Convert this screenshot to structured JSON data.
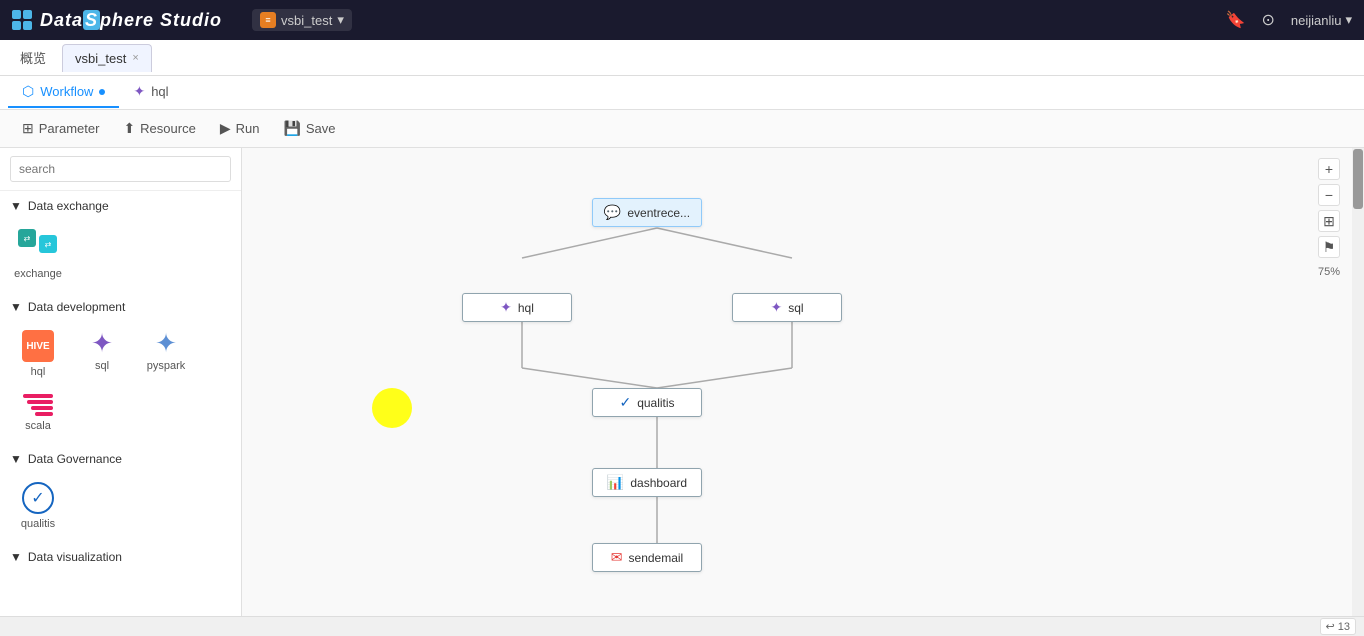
{
  "app": {
    "title": "DataSphere Studio"
  },
  "topbar": {
    "logo_text": "Data Sphere Studio",
    "project_name": "vsbi_test",
    "dropdown_arrow": "▾",
    "bookmark_icon": "🔖",
    "github_icon": "⊙",
    "user_name": "neijianliu",
    "user_arrow": "▾"
  },
  "tabs": {
    "overview_label": "概览",
    "project_tab_label": "vsbi_test",
    "close_label": "×"
  },
  "subtabs": {
    "workflow_label": "Workflow",
    "hql_label": "hql"
  },
  "toolbar": {
    "parameter_label": "Parameter",
    "resource_label": "Resource",
    "run_label": "Run",
    "save_label": "Save"
  },
  "sidebar": {
    "search_placeholder": "search",
    "sections": [
      {
        "id": "data-exchange",
        "label": "Data exchange",
        "items": [
          {
            "id": "exchange",
            "label": "exchange"
          }
        ]
      },
      {
        "id": "data-development",
        "label": "Data development",
        "items": [
          {
            "id": "hql",
            "label": "hql"
          },
          {
            "id": "sql",
            "label": "sql"
          },
          {
            "id": "pyspark",
            "label": "pyspark"
          },
          {
            "id": "scala",
            "label": "scala"
          }
        ]
      },
      {
        "id": "data-governance",
        "label": "Data Governance",
        "items": [
          {
            "id": "qualitis",
            "label": "qualitis"
          }
        ]
      },
      {
        "id": "data-visualization",
        "label": "Data visualization",
        "items": []
      }
    ]
  },
  "workflow": {
    "nodes": [
      {
        "id": "eventrece",
        "label": "eventrece...",
        "type": "event"
      },
      {
        "id": "hql",
        "label": "hql",
        "type": "hql"
      },
      {
        "id": "sql",
        "label": "sql",
        "type": "sql"
      },
      {
        "id": "qualitis",
        "label": "qualitis",
        "type": "qualitis"
      },
      {
        "id": "dashboard",
        "label": "dashboard",
        "type": "dashboard"
      },
      {
        "id": "sendemail",
        "label": "sendemail",
        "type": "email"
      }
    ]
  },
  "zoom": {
    "level": "75%",
    "zoom_in": "+",
    "zoom_out": "−",
    "fit": "⊞",
    "flag": "⚑"
  },
  "bottom": {
    "counter_icon": "↩",
    "counter_value": "13"
  }
}
